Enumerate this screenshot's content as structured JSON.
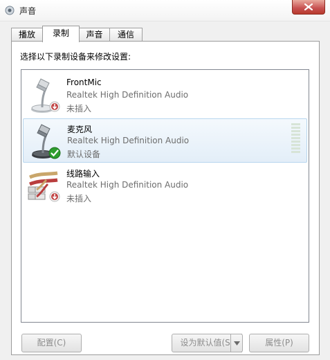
{
  "window": {
    "title": "声音"
  },
  "tabs": [
    {
      "label": "播放",
      "active": false
    },
    {
      "label": "录制",
      "active": true
    },
    {
      "label": "声音",
      "active": false
    },
    {
      "label": "通信",
      "active": false
    }
  ],
  "instruction": "选择以下录制设备来修改设置:",
  "devices": [
    {
      "name": "FrontMic",
      "description": "Realtek High Definition Audio",
      "status": "未插入",
      "icon": "microphone-icon",
      "badge": "unplugged-badge-icon"
    },
    {
      "name": "麦克风",
      "description": "Realtek High Definition Audio",
      "status": "默认设备",
      "icon": "microphone-icon",
      "badge": "default-check-icon",
      "selected": true
    },
    {
      "name": "线路输入",
      "description": "Realtek High Definition Audio",
      "status": "未插入",
      "icon": "line-in-cable-icon",
      "badge": "unplugged-badge-icon"
    }
  ],
  "buttons": {
    "configure": "配置(C)",
    "set_default": "设为默认值(S)",
    "properties": "属性(P)"
  },
  "colors": {
    "selection_bg": "#e3eef8",
    "close_button": "#c75050",
    "default_badge": "#2e9e2e",
    "unplugged_badge": "#c04545"
  }
}
